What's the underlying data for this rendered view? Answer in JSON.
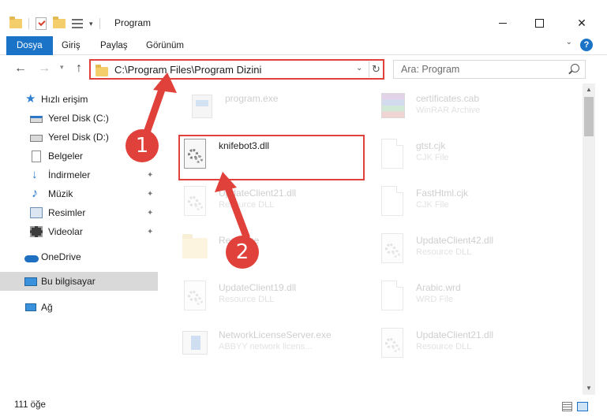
{
  "window": {
    "title": "Program",
    "close_glyph": "✕"
  },
  "ribbon": {
    "tabs": [
      "Dosya",
      "Giriş",
      "Paylaş",
      "Görünüm"
    ],
    "help_glyph": "?",
    "caret_glyph": "⌄"
  },
  "address": {
    "path": "C:\\Program Files\\Program Dizini",
    "search_placeholder": "Ara: Program",
    "back_glyph": "←",
    "forward_glyph": "→",
    "up_glyph": "↑",
    "refresh_glyph": "↻",
    "dropdown_glyph": "⌄"
  },
  "sidebar": {
    "items": [
      {
        "label": "Hızlı erişim",
        "icon": "star-icon"
      },
      {
        "label": "Yerel Disk (C:)",
        "icon": "drive-icon"
      },
      {
        "label": "Yerel Disk (D:)",
        "icon": "drive-icon"
      },
      {
        "label": "Belgeler",
        "icon": "documents-icon"
      },
      {
        "label": "İndirmeler",
        "icon": "download-icon"
      },
      {
        "label": "Müzik",
        "icon": "music-icon"
      },
      {
        "label": "Resimler",
        "icon": "pictures-icon"
      },
      {
        "label": "Videolar",
        "icon": "video-icon"
      },
      {
        "label": "OneDrive",
        "icon": "cloud-icon"
      },
      {
        "label": "Bu bilgisayar",
        "icon": "computer-icon"
      },
      {
        "label": "Ağ",
        "icon": "network-icon"
      }
    ],
    "pin_glyph": "📌"
  },
  "files": [
    {
      "name": "program.exe",
      "type": "",
      "icon": "exe-icon"
    },
    {
      "name": "certificates.cab",
      "type": "WinRAR Archive",
      "icon": "rar-icon"
    },
    {
      "name": "knifebot3.dll",
      "type": "",
      "icon": "dll-icon"
    },
    {
      "name": "gtst.cjk",
      "type": "CJK File",
      "icon": "blank-file-icon"
    },
    {
      "name": "UpdateClient21.dll",
      "type": "Resource DLL",
      "icon": "dll-icon"
    },
    {
      "name": "FastHtml.cjk",
      "type": "CJK File",
      "icon": "blank-file-icon"
    },
    {
      "name": "Resource",
      "type": "",
      "icon": "folder-icon"
    },
    {
      "name": "UpdateClient42.dll",
      "type": "Resource DLL",
      "icon": "dll-icon"
    },
    {
      "name": "UpdateClient19.dll",
      "type": "Resource DLL",
      "icon": "dll-icon"
    },
    {
      "name": "Arabic.wrd",
      "type": "WRD File",
      "icon": "blank-file-icon"
    },
    {
      "name": "NetworkLicenseServer.exe",
      "type": "ABBYY network licens...",
      "icon": "network-exe-icon"
    },
    {
      "name": "UpdateClient21.dll",
      "type": "Resource DLL",
      "icon": "dll-icon"
    }
  ],
  "status": {
    "item_count": "111 öğe"
  },
  "annotations": {
    "step1": "1",
    "step2": "2",
    "color": "#e0413a"
  },
  "scrollbar": {
    "up_glyph": "▲",
    "down_glyph": "▼"
  }
}
